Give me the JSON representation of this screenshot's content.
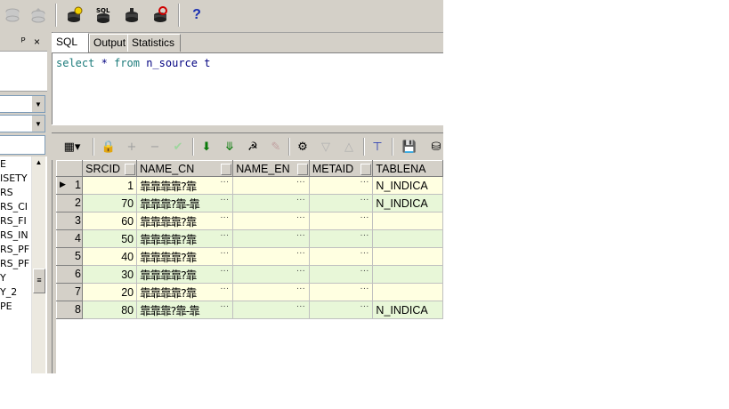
{
  "toolbar": {
    "buttons": [
      {
        "icon": "db-disabled-icon"
      },
      {
        "icon": "db-up-disabled-icon"
      },
      {
        "icon": "db-connect-icon"
      },
      {
        "icon": "sql-window-icon"
      },
      {
        "icon": "command-window-icon"
      },
      {
        "icon": "refresh-db-icon"
      }
    ],
    "help_label": "?"
  },
  "left_panel": {
    "pin_glyph": "ᵖ",
    "close_glyph": "×",
    "items": [
      "E",
      "ISETY",
      "RS",
      "RS_CI",
      "RS_FI",
      "RS_IN",
      "RS_PF",
      "RS_PF",
      "Y",
      "Y_2",
      "PE"
    ]
  },
  "tabs": [
    {
      "label": "SQL",
      "active": true
    },
    {
      "label": "Output",
      "active": false
    },
    {
      "label": "Statistics",
      "active": false
    }
  ],
  "editor": {
    "kw1": "select",
    "star": "*",
    "kw2": "from",
    "table": "n_source",
    "alias": "t"
  },
  "grid": {
    "columns": [
      "SRCID",
      "NAME_CN",
      "NAME_EN",
      "METAID",
      "TABLENA"
    ],
    "rows": [
      {
        "n": "1",
        "srcid": "1",
        "name_cn": "靠靠靠靠?靠",
        "name_en": "",
        "metaid": "",
        "tablename": "N_INDICA",
        "current": true
      },
      {
        "n": "2",
        "srcid": "70",
        "name_cn": "靠靠靠?靠-靠",
        "name_en": "",
        "metaid": "",
        "tablename": "N_INDICA",
        "current": false
      },
      {
        "n": "3",
        "srcid": "60",
        "name_cn": "靠靠靠靠?靠",
        "name_en": "",
        "metaid": "",
        "tablename": "",
        "current": false
      },
      {
        "n": "4",
        "srcid": "50",
        "name_cn": "靠靠靠靠?靠",
        "name_en": "",
        "metaid": "",
        "tablename": "",
        "current": false
      },
      {
        "n": "5",
        "srcid": "40",
        "name_cn": "靠靠靠靠?靠",
        "name_en": "",
        "metaid": "",
        "tablename": "",
        "current": false
      },
      {
        "n": "6",
        "srcid": "30",
        "name_cn": "靠靠靠靠?靠",
        "name_en": "",
        "metaid": "",
        "tablename": "",
        "current": false
      },
      {
        "n": "7",
        "srcid": "20",
        "name_cn": "靠靠靠靠?靠",
        "name_en": "",
        "metaid": "",
        "tablename": "",
        "current": false
      },
      {
        "n": "8",
        "srcid": "80",
        "name_cn": "靠靠靠?靠-靠",
        "name_en": "",
        "metaid": "",
        "tablename": "N_INDICA",
        "current": false
      }
    ],
    "ellipsis": "···"
  },
  "colors": {
    "odd_row": "#ffffe1",
    "even_row": "#e8f7d8",
    "keyword": "#1a7a7a"
  }
}
